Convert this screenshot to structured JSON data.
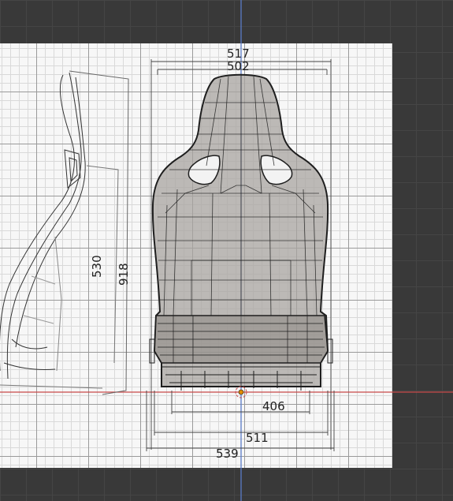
{
  "viewport": {
    "name": "3d-viewport",
    "background": "#393939"
  },
  "reference_image": {
    "name": "seat-blueprint-reference",
    "dimensions": {
      "top_outer_width": "517",
      "top_inner_width": "502",
      "seat_depth": "530",
      "total_height": "918",
      "base_width": "406",
      "mid_width": "511",
      "bottom_width": "539"
    }
  },
  "axes": {
    "y_axis_color": "#5a7cc8",
    "x_axis_color": "#c84a4a"
  },
  "origin_marker": {
    "name": "3d-cursor",
    "color": "#e08a00"
  },
  "mesh": {
    "name": "seat-mesh",
    "wire_color": "#1e1e1e",
    "fill_color": "#a8a4a0"
  }
}
